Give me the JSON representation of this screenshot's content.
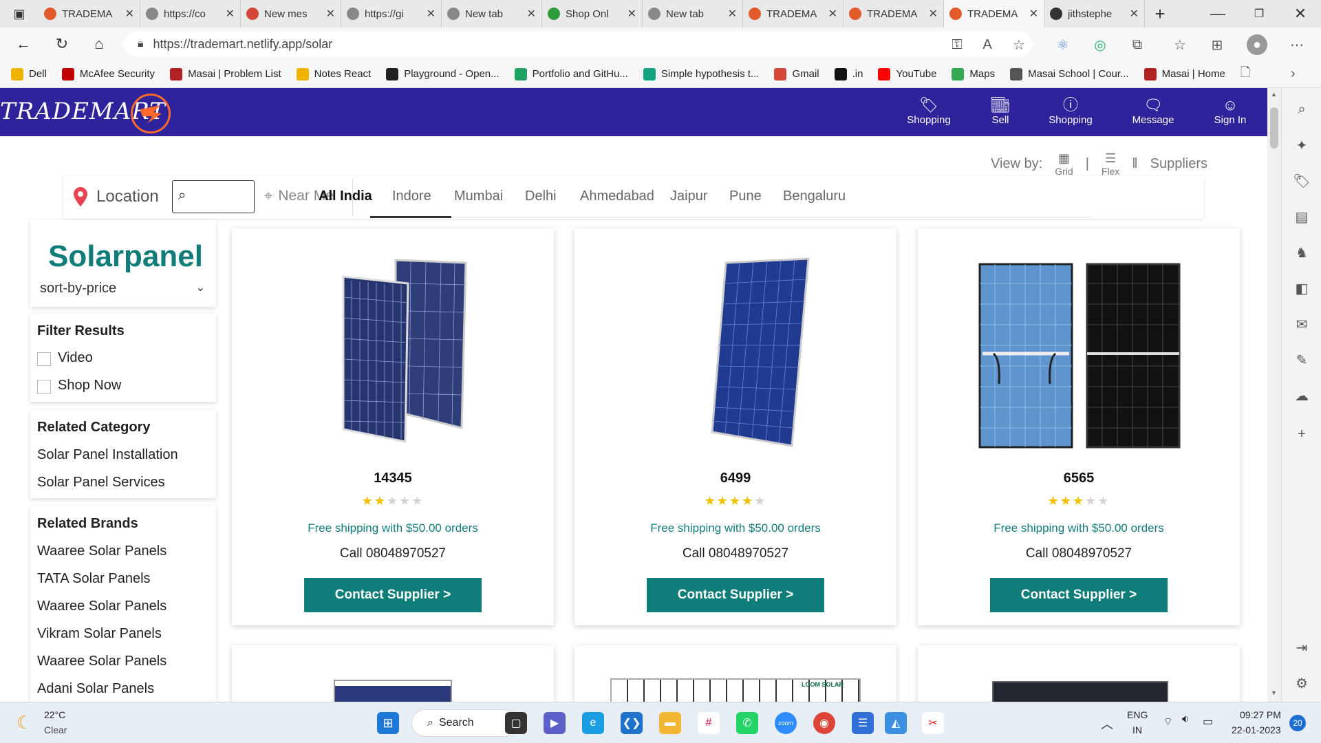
{
  "browser": {
    "tabs": [
      {
        "title": "TRADEMA",
        "color": "#e35b2a",
        "active": false
      },
      {
        "title": "https://co",
        "color": "#888888",
        "active": false
      },
      {
        "title": "New mes",
        "color": "#d44638",
        "active": false
      },
      {
        "title": "https://gi",
        "color": "#888888",
        "active": false
      },
      {
        "title": "New tab",
        "color": "#888888",
        "active": false
      },
      {
        "title": "Shop Onl",
        "color": "#2e9c3b",
        "active": false
      },
      {
        "title": "New tab",
        "color": "#888888",
        "active": false
      },
      {
        "title": "TRADEMA",
        "color": "#e35b2a",
        "active": false
      },
      {
        "title": "TRADEMA",
        "color": "#e35b2a",
        "active": false
      },
      {
        "title": "TRADEMA",
        "color": "#e35b2a",
        "active": true
      },
      {
        "title": "jithstephe",
        "color": "#333333",
        "active": false
      }
    ],
    "url": "https://trademart.netlify.app/solar",
    "bookmarks": [
      {
        "label": "Dell",
        "color": "#f0b400"
      },
      {
        "label": "McAfee Security",
        "color": "#c00000"
      },
      {
        "label": "Masai | Problem List",
        "color": "#b22222"
      },
      {
        "label": "Notes React",
        "color": "#f0b400"
      },
      {
        "label": "Playground - Open...",
        "color": "#222222"
      },
      {
        "label": "Portfolio and GitHu...",
        "color": "#1ea362"
      },
      {
        "label": "Simple hypothesis t...",
        "color": "#14a37f"
      },
      {
        "label": "Gmail",
        "color": "#d44638"
      },
      {
        "label": ".in",
        "color": "#111111"
      },
      {
        "label": "YouTube",
        "color": "#ff0000"
      },
      {
        "label": "Maps",
        "color": "#34a853"
      },
      {
        "label": "Masai School | Cour...",
        "color": "#555555"
      },
      {
        "label": "Masai | Home",
        "color": "#b22222"
      }
    ]
  },
  "site": {
    "logo": "TRADEMART",
    "nav": [
      {
        "label": "Shopping",
        "icon": "tag-icon"
      },
      {
        "label": "Sell",
        "icon": "store-icon"
      },
      {
        "label": "Shopping",
        "icon": "help-icon"
      },
      {
        "label": "Message",
        "icon": "message-icon"
      },
      {
        "label": "Sign In",
        "icon": "user-icon"
      }
    ],
    "view_by": {
      "label": "View by:",
      "grid": "Grid",
      "flex": "Flex",
      "suppliers": "Suppliers"
    },
    "location": {
      "label": "Location",
      "near_me": "Near Me",
      "cities": [
        "All India",
        "Indore",
        "Mumbai",
        "Delhi",
        "Ahmedabad",
        "Jaipur",
        "Pune",
        "Bengaluru"
      ],
      "active_city": "All India"
    },
    "sidebar": {
      "category_title": "Solarpanel",
      "sort_label": "sort-by-price",
      "filter_heading": "Filter Results",
      "filters": [
        "Video",
        "Shop Now"
      ],
      "related_category_heading": "Related Category",
      "related_categories": [
        "Solar Panel Installation",
        "Solar Panel Services"
      ],
      "related_brands_heading": "Related Brands",
      "related_brands": [
        "Waaree Solar Panels",
        "TATA Solar Panels",
        "Waaree Solar Panels",
        "Vikram Solar Panels",
        "Waaree Solar Panels",
        "Adani Solar Panels"
      ]
    },
    "products": [
      {
        "price": "14345",
        "rating": 2,
        "shipping": "Free shipping with $50.00 orders",
        "call": "Call 08048970527",
        "button": "Contact Supplier >"
      },
      {
        "price": "6499",
        "rating": 4,
        "shipping": "Free shipping with $50.00 orders",
        "call": "Call 08048970527",
        "button": "Contact Supplier >"
      },
      {
        "price": "6565",
        "rating": 3,
        "shipping": "Free shipping with $50.00 orders",
        "call": "Call 08048970527",
        "button": "Contact Supplier >"
      }
    ],
    "second_row_label": "LOOM SOLAR"
  },
  "taskbar": {
    "weather_temp": "22°C",
    "weather_desc": "Clear",
    "search_label": "Search",
    "lang_top": "ENG",
    "lang_bottom": "IN",
    "time": "09:27 PM",
    "date": "22-01-2023",
    "notif_count": "20"
  }
}
